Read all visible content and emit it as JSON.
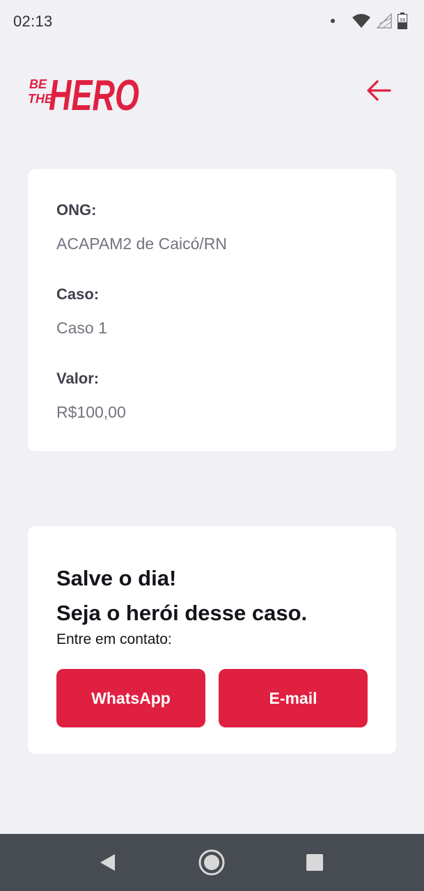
{
  "status_bar": {
    "time": "02:13",
    "icons": [
      "notification-dot",
      "wifi-icon",
      "signal-icon",
      "battery-icon"
    ],
    "battery_level": "36"
  },
  "header": {
    "logo": {
      "line1": "BE",
      "line2": "THE",
      "word": "HERO"
    },
    "back_icon": "arrow-left-icon"
  },
  "incident": {
    "fields": [
      {
        "label": "ONG:",
        "value": "ACAPAM2 de Caicó/RN"
      },
      {
        "label": "Caso:",
        "value": "Caso 1"
      },
      {
        "label": "Valor:",
        "value": "R$100,00"
      }
    ]
  },
  "contact": {
    "headline_1": "Salve o dia!",
    "headline_2": "Seja o herói desse caso.",
    "description": "Entre em contato:",
    "whatsapp_label": "WhatsApp",
    "email_label": "E-mail"
  },
  "nav_bar": {
    "buttons": [
      "back-triangle-icon",
      "home-circle-icon",
      "recents-square-icon"
    ]
  },
  "colors": {
    "accent": "#e02041",
    "background": "#f0f0f5",
    "card": "#ffffff",
    "nav_bar": "#474b52",
    "label": "#41414d",
    "value": "#737380"
  }
}
